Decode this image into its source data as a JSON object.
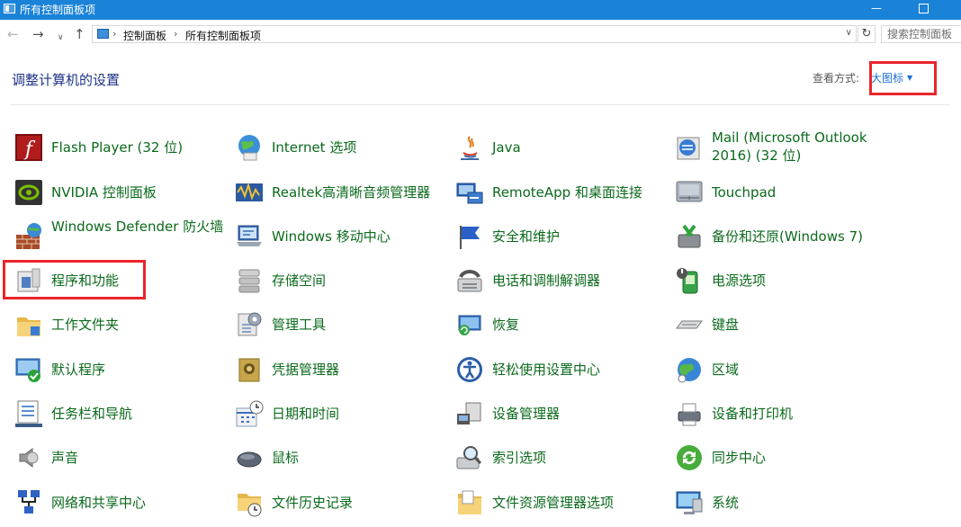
{
  "window": {
    "title": "所有控制面板项",
    "minimize_glyph": "—"
  },
  "nav": {
    "back_glyph": "←",
    "forward_glyph": "→",
    "recent_glyph": "∨",
    "up_glyph": "↑"
  },
  "address": {
    "icon": "control-panel-icon",
    "crumbs": [
      "控制面板",
      "所有控制面板项"
    ],
    "separator_glyph": "›",
    "dropdown_glyph": "∨",
    "refresh_glyph": "↻"
  },
  "search": {
    "placeholder": "搜索控制面板"
  },
  "heading": "调整计算机的设置",
  "view": {
    "label": "查看方式:",
    "value": "大图标"
  },
  "colors": {
    "titlebar": "#1a83d8",
    "item_text": "#0b6a1c",
    "heading": "#1e3287",
    "link": "#1a6ed8",
    "highlight": "#e8262b"
  },
  "items": [
    [
      {
        "label": "Flash Player (32 位)",
        "icon": "flash-player-icon"
      },
      {
        "label": "NVIDIA 控制面板",
        "icon": "nvidia-icon"
      },
      {
        "label": "Windows Defender 防火墙",
        "icon": "firewall-icon"
      },
      {
        "label": "程序和功能",
        "icon": "programs-features-icon"
      },
      {
        "label": "工作文件夹",
        "icon": "work-folders-icon"
      },
      {
        "label": "默认程序",
        "icon": "default-programs-icon"
      },
      {
        "label": "任务栏和导航",
        "icon": "taskbar-icon"
      },
      {
        "label": "声音",
        "icon": "sound-icon"
      },
      {
        "label": "网络和共享中心",
        "icon": "network-icon"
      }
    ],
    [
      {
        "label": "Internet 选项",
        "icon": "internet-options-icon"
      },
      {
        "label": "Realtek高清晰音频管理器",
        "icon": "realtek-audio-icon"
      },
      {
        "label": "Windows 移动中心",
        "icon": "mobility-center-icon"
      },
      {
        "label": "存储空间",
        "icon": "storage-spaces-icon"
      },
      {
        "label": "管理工具",
        "icon": "admin-tools-icon"
      },
      {
        "label": "凭据管理器",
        "icon": "credential-manager-icon"
      },
      {
        "label": "日期和时间",
        "icon": "date-time-icon"
      },
      {
        "label": "鼠标",
        "icon": "mouse-icon"
      },
      {
        "label": "文件历史记录",
        "icon": "file-history-icon"
      }
    ],
    [
      {
        "label": "Java",
        "icon": "java-icon"
      },
      {
        "label": "RemoteApp 和桌面连接",
        "icon": "remoteapp-icon"
      },
      {
        "label": "安全和维护",
        "icon": "security-maintenance-icon"
      },
      {
        "label": "电话和调制解调器",
        "icon": "phone-modem-icon"
      },
      {
        "label": "恢复",
        "icon": "recovery-icon"
      },
      {
        "label": "轻松使用设置中心",
        "icon": "ease-of-access-icon"
      },
      {
        "label": "设备管理器",
        "icon": "device-manager-icon"
      },
      {
        "label": "索引选项",
        "icon": "indexing-options-icon"
      },
      {
        "label": "文件资源管理器选项",
        "icon": "explorer-options-icon"
      }
    ],
    [
      {
        "label": "Mail (Microsoft Outlook 2016) (32 位)",
        "icon": "mail-icon"
      },
      {
        "label": "Touchpad",
        "icon": "touchpad-icon"
      },
      {
        "label": "备份和还原(Windows 7)",
        "icon": "backup-restore-icon"
      },
      {
        "label": "电源选项",
        "icon": "power-options-icon"
      },
      {
        "label": "键盘",
        "icon": "keyboard-icon"
      },
      {
        "label": "区域",
        "icon": "region-icon"
      },
      {
        "label": "设备和打印机",
        "icon": "devices-printers-icon"
      },
      {
        "label": "同步中心",
        "icon": "sync-center-icon"
      },
      {
        "label": "系统",
        "icon": "system-icon"
      }
    ]
  ]
}
